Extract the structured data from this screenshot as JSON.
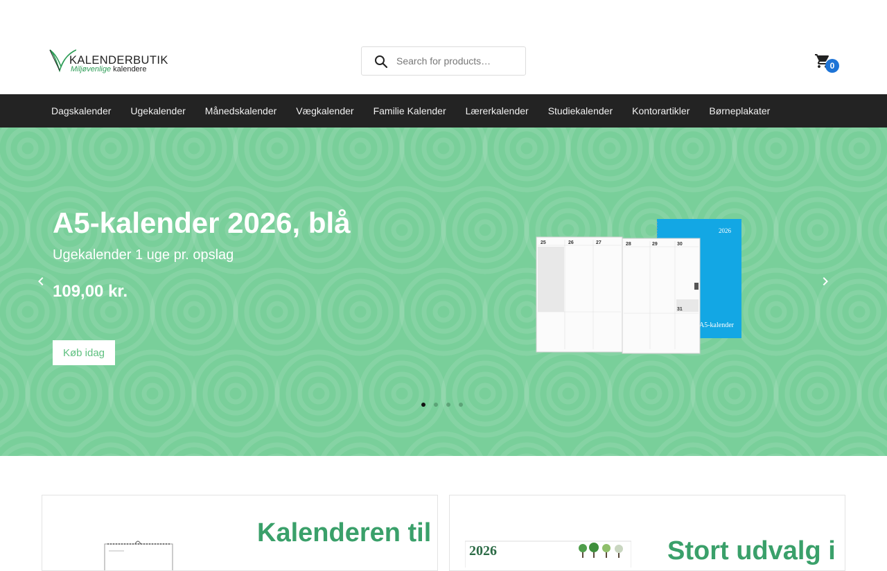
{
  "brand": {
    "logo_main": "KALENDERBUTIK",
    "logo_sub_green": "Miljøvenlige",
    "logo_sub_dark": "kalendere",
    "accent": "#2e9d57"
  },
  "search": {
    "placeholder": "Search for products…",
    "icon": "search-icon"
  },
  "cart": {
    "icon": "cart-icon",
    "count": "0",
    "badge_color": "#1e74d6"
  },
  "nav": {
    "items": [
      {
        "label": "Dagskalender"
      },
      {
        "label": "Ugekalender"
      },
      {
        "label": "Månedskalender"
      },
      {
        "label": "Vægkalender"
      },
      {
        "label": "Familie Kalender"
      },
      {
        "label": "Lærerkalender"
      },
      {
        "label": "Studiekalender"
      },
      {
        "label": "Kontorartikler"
      },
      {
        "label": "Børneplakater"
      }
    ]
  },
  "hero": {
    "title": "A5-kalender 2026, blå",
    "subtitle": "Ugekalender 1 uge pr. opslag",
    "price": "109,00 kr.",
    "button_label": "Køb idag",
    "background": "#79cf9a",
    "product_year": "2026",
    "product_label": "A5-kalender",
    "page_days": [
      "25",
      "26",
      "27",
      "28",
      "29",
      "30",
      "31"
    ],
    "slides": 4,
    "active_slide": 1
  },
  "cards": [
    {
      "title": "Kalenderen til"
    },
    {
      "title": "Stort udvalg i",
      "thumb_text": "2026"
    }
  ]
}
